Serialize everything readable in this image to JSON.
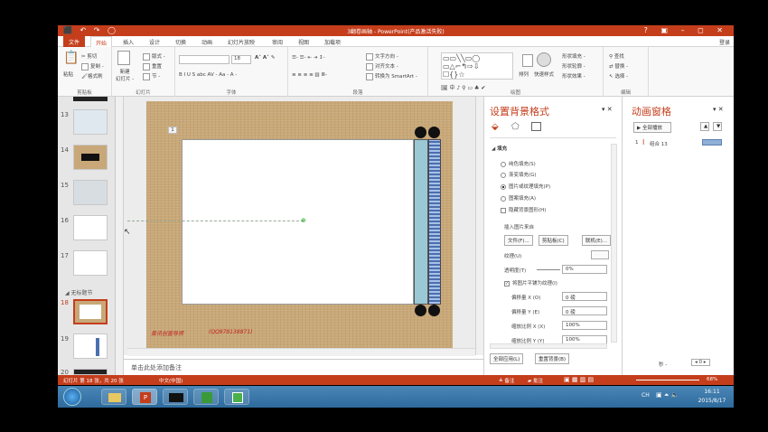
{
  "window": {
    "title": "3翻卷画轴 - PowerPoint(产品激活失败)",
    "quick_access": "⬛ ↶ ↷ ◯",
    "controls": "? ▣ – ◻ ✕",
    "login": "登录"
  },
  "tabs": [
    {
      "label": "文件"
    },
    {
      "label": "开始"
    },
    {
      "label": "插入"
    },
    {
      "label": "设计"
    },
    {
      "label": "切换"
    },
    {
      "label": "动画"
    },
    {
      "label": "幻灯片放映"
    },
    {
      "label": "审阅"
    },
    {
      "label": "视图"
    },
    {
      "label": "加载项"
    }
  ],
  "ribbon": {
    "clipboard": {
      "paste": "粘贴",
      "cut": "剪切",
      "copy": "复制 -",
      "format_painter": "格式刷",
      "label": "剪贴板"
    },
    "slides": {
      "new_slide": "新建\n幻灯片 -",
      "layout": "版式 -",
      "reset": "重置",
      "section": "节 -",
      "label": "幻灯片"
    },
    "font": {
      "size": "18",
      "label": "字体",
      "format": "B I U S abc AV - Aa - A -"
    },
    "paragraph": {
      "text_direction": "文字方向 -",
      "align_text": "对齐文本 -",
      "smartart": "转换为 SmartArt -",
      "label": "段落"
    },
    "drawing": {
      "arrange": "排列",
      "quick_styles": "快速样式",
      "shape_fill": "形状填充 -",
      "shape_outline": "形状轮廓 -",
      "shape_effects": "形状效果 -",
      "label": "绘图"
    },
    "editing": {
      "find": "查找",
      "replace": "替换 -",
      "select": "选择 -",
      "label": "编辑"
    }
  },
  "thumbnails": [
    {
      "num": "13"
    },
    {
      "num": "14"
    },
    {
      "num": "15"
    },
    {
      "num": "16"
    },
    {
      "num": "17"
    },
    {
      "num": "18"
    },
    {
      "num": "19"
    },
    {
      "num": "20"
    }
  ],
  "section_label": "无标题节",
  "slide": {
    "badge": "1",
    "author": "黄讯创富导师",
    "qq": "(QQ978138871)"
  },
  "notes_placeholder": "单击此处添加备注",
  "bg_pane": {
    "title": "设置背景格式",
    "fill_header": "填充",
    "options": [
      {
        "label": "纯色填充(S)",
        "checked": false
      },
      {
        "label": "渐变填充(G)",
        "checked": false
      },
      {
        "label": "图片或纹理填充(P)",
        "checked": true
      },
      {
        "label": "图案填充(A)",
        "checked": false
      }
    ],
    "hide_bg": "隐藏背景图形(H)",
    "insert_from": "插入图片来自",
    "file_btn": "文件(F)...",
    "clipboard_btn": "剪贴板(C)",
    "online_btn": "联机(E)...",
    "texture_label": "纹理(U)",
    "transparency_label": "透明度(T)",
    "transparency_value": "0%",
    "tile": "将图片平铺为纹理(I)",
    "offset_x_label": "偏移量 X (O)",
    "offset_x_value": "0 磅",
    "offset_y_label": "偏移量 Y (E)",
    "offset_y_value": "0 磅",
    "scale_x_label": "缩放比例 X (X)",
    "scale_x_value": "100%",
    "scale_y_label": "缩放比例 Y (Y)",
    "scale_y_value": "100%",
    "apply_all": "全部应用(L)",
    "reset_bg": "重置背景(B)"
  },
  "anim_pane": {
    "title": "动画窗格",
    "play_all": "全部播放",
    "item_num": "1",
    "item_label": "组合 13",
    "seconds": "秒 -",
    "zoom_value": "0"
  },
  "status": {
    "slide_info": "幻灯片 第 18 张，共 20 张",
    "lang": "中文(中国)",
    "notes": "备注",
    "comments": "批注",
    "zoom": "68%"
  },
  "taskbar": {
    "time": "16:11",
    "date": "2015/8/17",
    "ime": "CH"
  }
}
